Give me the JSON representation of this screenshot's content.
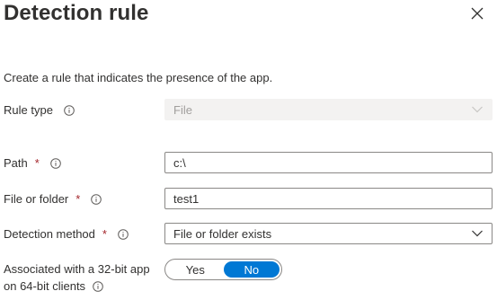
{
  "panel": {
    "title": "Detection rule",
    "description": "Create a rule that indicates the presence of the app."
  },
  "rule_type": {
    "label": "Rule type",
    "value": "File",
    "disabled": true
  },
  "path": {
    "label": "Path",
    "required_marker": "*",
    "value": "c:\\"
  },
  "file_or_folder": {
    "label": "File or folder",
    "required_marker": "*",
    "value": "test1"
  },
  "detection_method": {
    "label": "Detection method",
    "required_marker": "*",
    "value": "File or folder exists"
  },
  "bitness": {
    "label_line1": "Associated with a 32-bit app",
    "label_line2": "on 64-bit clients",
    "yes_label": "Yes",
    "no_label": "No",
    "selected": "No"
  },
  "colors": {
    "accent": "#0078d4",
    "required": "#a4262c",
    "text": "#323130"
  },
  "icons": [
    "close-icon",
    "info-icon",
    "chevron-down-icon"
  ]
}
